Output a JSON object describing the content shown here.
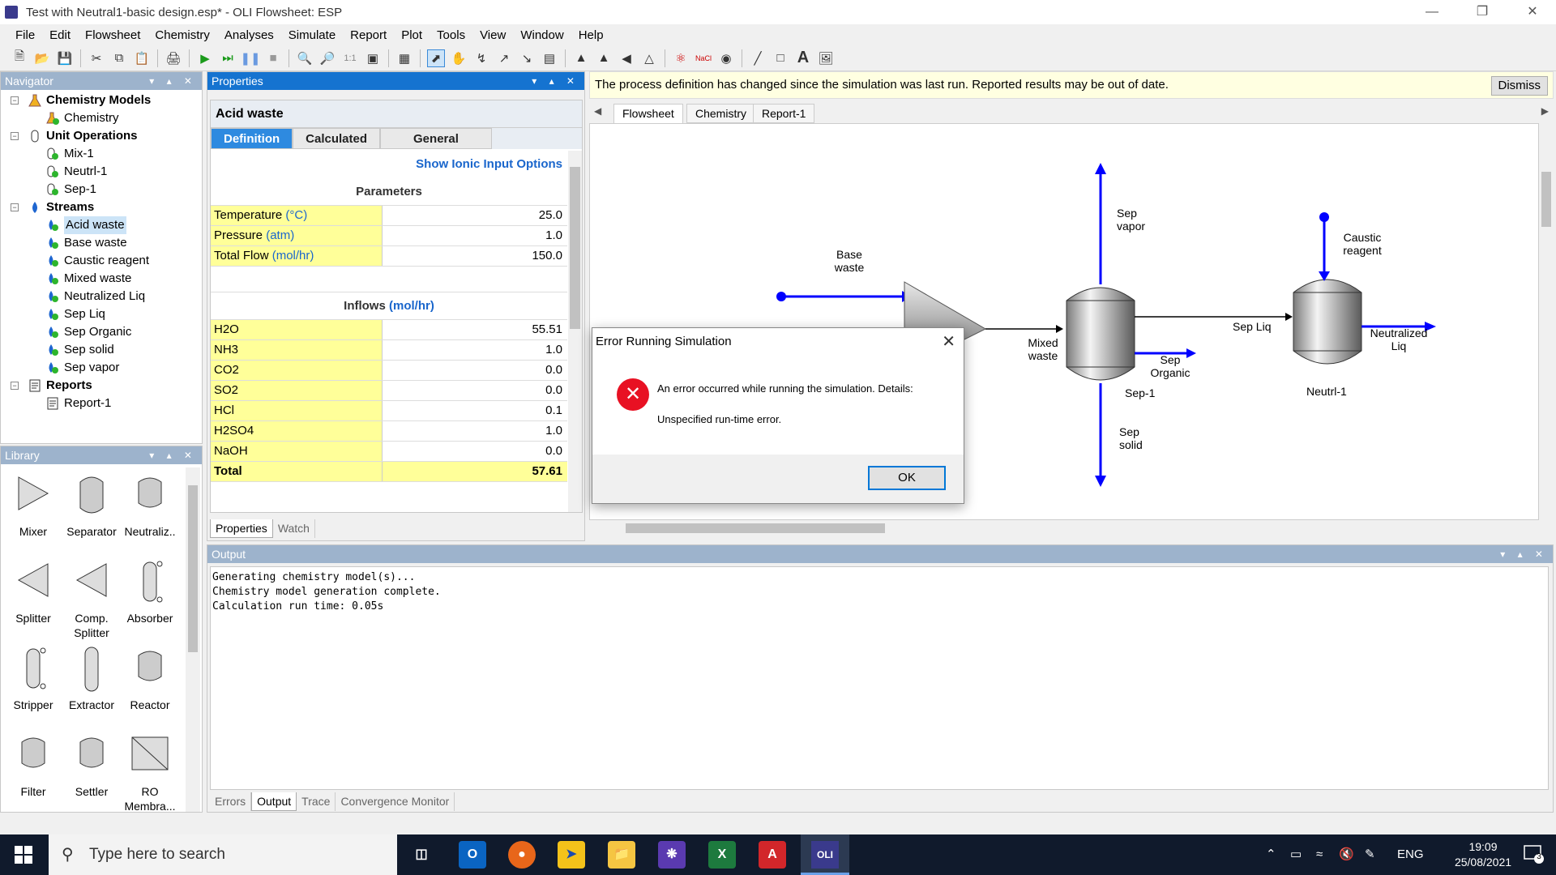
{
  "window": {
    "title": "Test with Neutral1-basic design.esp* - OLI Flowsheet: ESP",
    "app_badge": "OLI"
  },
  "menu": [
    "File",
    "Edit",
    "Flowsheet",
    "Chemistry",
    "Analyses",
    "Simulate",
    "Report",
    "Plot",
    "Tools",
    "View",
    "Window",
    "Help"
  ],
  "navigator": {
    "title": "Navigator",
    "items": [
      {
        "label": "Chemistry Models",
        "level": 0,
        "bold": true,
        "expander": "−",
        "icon": "flask-icon"
      },
      {
        "label": "Chemistry",
        "level": 1,
        "icon": "flask-check-icon"
      },
      {
        "label": "Unit Operations",
        "level": 0,
        "bold": true,
        "expander": "−",
        "icon": "vessel-icon"
      },
      {
        "label": "Mix-1",
        "level": 1,
        "icon": "unit-check-icon"
      },
      {
        "label": "Neutrl-1",
        "level": 1,
        "icon": "unit-check-icon"
      },
      {
        "label": "Sep-1",
        "level": 1,
        "icon": "unit-check-icon"
      },
      {
        "label": "Streams",
        "level": 0,
        "bold": true,
        "expander": "−",
        "icon": "drop-icon"
      },
      {
        "label": "Acid waste",
        "level": 1,
        "icon": "stream-check-icon",
        "selected": true
      },
      {
        "label": "Base waste",
        "level": 1,
        "icon": "stream-check-icon"
      },
      {
        "label": "Caustic reagent",
        "level": 1,
        "icon": "stream-check-icon"
      },
      {
        "label": "Mixed waste",
        "level": 1,
        "icon": "stream-check-icon"
      },
      {
        "label": "Neutralized Liq",
        "level": 1,
        "icon": "stream-check-icon"
      },
      {
        "label": "Sep Liq",
        "level": 1,
        "icon": "stream-check-icon"
      },
      {
        "label": "Sep Organic",
        "level": 1,
        "icon": "stream-check-icon"
      },
      {
        "label": "Sep solid",
        "level": 1,
        "icon": "stream-check-icon"
      },
      {
        "label": "Sep vapor",
        "level": 1,
        "icon": "stream-check-icon"
      },
      {
        "label": "Reports",
        "level": 0,
        "bold": true,
        "expander": "−",
        "icon": "report-icon"
      },
      {
        "label": "Report-1",
        "level": 1,
        "icon": "report-icon"
      }
    ]
  },
  "library": {
    "title": "Library",
    "items": [
      {
        "label": "Mixer",
        "shape": "mixer"
      },
      {
        "label": "Separator",
        "shape": "vessel"
      },
      {
        "label": "Neutraliz..",
        "shape": "vessel-small"
      },
      {
        "label": "Splitter",
        "shape": "splitter"
      },
      {
        "label": "Comp. Splitter",
        "shape": "splitter"
      },
      {
        "label": "Absorber",
        "shape": "column"
      },
      {
        "label": "Stripper",
        "shape": "column"
      },
      {
        "label": "Extractor",
        "shape": "tall"
      },
      {
        "label": "Reactor",
        "shape": "vessel-small"
      },
      {
        "label": "Filter",
        "shape": "vessel-small"
      },
      {
        "label": "Settler",
        "shape": "vessel-small"
      },
      {
        "label": "RO Membra...",
        "shape": "ro"
      }
    ]
  },
  "properties": {
    "title": "Properties",
    "object_name": "Acid waste",
    "tabs": [
      "Definition",
      "Calculated",
      "General"
    ],
    "active_tab": "Definition",
    "ionic_link": "Show Ionic Input Options",
    "parameters_title": "Parameters",
    "parameters": [
      {
        "name": "Temperature",
        "unit": "(°C)",
        "value": "25.0"
      },
      {
        "name": "Pressure",
        "unit": "(atm)",
        "value": "1.0"
      },
      {
        "name": "Total Flow",
        "unit": "(mol/hr)",
        "value": "150.0"
      }
    ],
    "inflows_title": "Inflows",
    "inflows_unit": "(mol/hr)",
    "inflows": [
      {
        "name": "H2O",
        "value": "55.51"
      },
      {
        "name": "NH3",
        "value": "1.0"
      },
      {
        "name": "CO2",
        "value": "0.0"
      },
      {
        "name": "SO2",
        "value": "0.0"
      },
      {
        "name": "HCl",
        "value": "0.1"
      },
      {
        "name": "H2SO4",
        "value": "1.0"
      },
      {
        "name": "NaOH",
        "value": "0.0"
      }
    ],
    "total_label": "Total",
    "total_value": "57.61",
    "bottom_tabs": [
      "Properties",
      "Watch"
    ]
  },
  "notice": {
    "text": "The process definition has changed since the simulation was last run. Reported results may be out of date.",
    "dismiss": "Dismiss"
  },
  "flowsheet_tabs": [
    "Flowsheet",
    "Chemistry",
    "Report-1"
  ],
  "flowsheet": {
    "labels": {
      "base_waste": "Base waste",
      "mixed_waste": "Mixed waste",
      "sep_vapor": "Sep vapor",
      "sep_organic": "Sep Organic",
      "sep_solid": "Sep solid",
      "sep_liq": "Sep Liq",
      "sep1": "Sep-1",
      "caustic": "Caustic reagent",
      "neutralized": "Neutralized Liq",
      "neutrl1": "Neutrl-1"
    },
    "stream_color": "#0000ff"
  },
  "output": {
    "title": "Output",
    "lines": "Generating chemistry model(s)...\nChemistry model generation complete.\nCalculation run time: 0.05s",
    "tabs": [
      "Errors",
      "Output",
      "Trace",
      "Convergence Monitor"
    ],
    "active_tab": "Output"
  },
  "dialog": {
    "title": "Error Running Simulation",
    "message": "An error occurred while running the simulation. Details:",
    "detail": "Unspecified run-time error.",
    "ok": "OK"
  },
  "taskbar": {
    "search_placeholder": "Type here to search",
    "lang": "ENG",
    "time": "19:09",
    "date": "25/08/2021",
    "notif_count": "3"
  }
}
